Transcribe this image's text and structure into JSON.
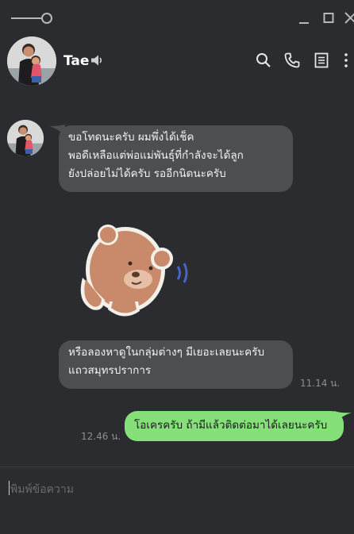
{
  "window": {
    "controls": [
      "pin-icon",
      "minimize-icon",
      "maximize-icon",
      "close-icon"
    ]
  },
  "header": {
    "contact_name": "Tae",
    "icons": [
      "speaker-icon",
      "search-icon",
      "phone-icon",
      "notes-icon",
      "more-icon"
    ]
  },
  "messages": [
    {
      "direction": "incoming",
      "type": "text",
      "text": "ขอโทดนะครับ ผมพึ่งได้เช็ค\nพอดีเหลือแต่พ่อแม่พันธุ์ที่กำลังจะได้ลูก\nยังปล่อยไม่ได้ครับ รออีกนิดนะครับ"
    },
    {
      "direction": "incoming",
      "type": "sticker",
      "sticker": "brown-bear-peeking-sticker"
    },
    {
      "direction": "incoming",
      "type": "text",
      "text": "หรือลองหาดูในกลุ่มต่างๆ มีเยอะเลยนะครับ\nแถวสมุทรปราการ",
      "time": "11.14 น."
    },
    {
      "direction": "outgoing",
      "type": "text",
      "text": "โอเครครับ ถ้ามีแล้วติดต่อมาได้เลยนะครับ",
      "time": "12.46 น."
    }
  ],
  "composer": {
    "placeholder": "พิมพ์ข้อความ"
  },
  "colors": {
    "background": "#2b2c30",
    "incoming_bubble": "#4d4e52",
    "outgoing_bubble": "#85e07a"
  }
}
